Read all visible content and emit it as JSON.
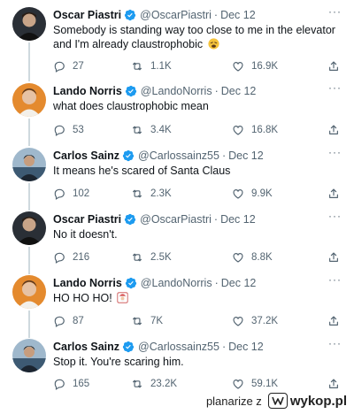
{
  "tweets": [
    {
      "author": "Oscar Piastri",
      "handle": "@OscarPiastri",
      "dot": "·",
      "date": "Dec 12",
      "text": "Somebody is standing way too close to me in the elevator and I'm already claustrophobic",
      "emoji": "weary-face-emoji",
      "replies": "27",
      "retweets": "1.1K",
      "likes": "16.9K",
      "avatar": "piastri-avatar"
    },
    {
      "author": "Lando Norris",
      "handle": "@LandoNorris",
      "dot": "·",
      "date": "Dec 12",
      "text": "what does claustrophobic mean",
      "replies": "53",
      "retweets": "3.4K",
      "likes": "16.8K",
      "avatar": "norris-avatar"
    },
    {
      "author": "Carlos Sainz",
      "handle": "@Carlossainz55",
      "dot": "·",
      "date": "Dec 12",
      "text": "It means he's scared of Santa Claus",
      "replies": "102",
      "retweets": "2.3K",
      "likes": "9.9K",
      "avatar": "sainz-avatar"
    },
    {
      "author": "Oscar Piastri",
      "handle": "@OscarPiastri",
      "dot": "·",
      "date": "Dec 12",
      "text": "No it doesn't.",
      "replies": "216",
      "retweets": "2.5K",
      "likes": "8.8K",
      "avatar": "piastri-avatar"
    },
    {
      "author": "Lando Norris",
      "handle": "@LandoNorris",
      "dot": "·",
      "date": "Dec 12",
      "text": "HO HO HO!",
      "emoji": "santa-emoji",
      "replies": "87",
      "retweets": "7K",
      "likes": "37.2K",
      "avatar": "norris-avatar"
    },
    {
      "author": "Carlos Sainz",
      "handle": "@Carlossainz55",
      "dot": "·",
      "date": "Dec 12",
      "text": "Stop it. You're scaring him.",
      "replies": "165",
      "retweets": "23.2K",
      "likes": "59.1K",
      "avatar": "sainz-avatar"
    }
  ],
  "more_glyph": "···",
  "watermark": {
    "user": "planarize z",
    "site": "wykop.pl"
  },
  "colors": {
    "text": "#0f1419",
    "muted": "#536471",
    "verified": "#1d9bf0",
    "thread_line": "#cfd9de"
  }
}
